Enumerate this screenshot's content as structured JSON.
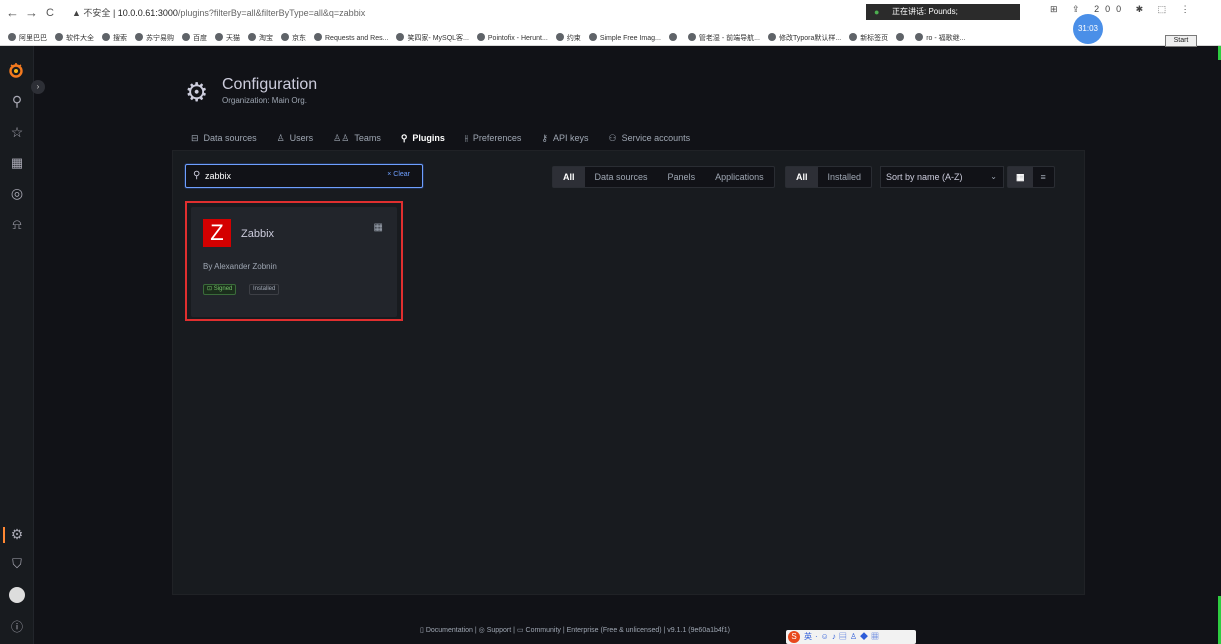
{
  "browser": {
    "nav": {
      "back": "←",
      "forward": "→",
      "reload": "C"
    },
    "security_label": "▲ 不安全",
    "url_host": "10.0.0.61:3000",
    "url_path": "/plugins?filterBy=all&filterByType=all&q=zabbix",
    "speech_text": "正在讲话: Pounds;",
    "clock_text": "31:03",
    "tray_text": "⊞ ⇪ 200 ✱ ⬚ ⋮",
    "start_label": "Start",
    "bookmarks": [
      "阿里巴巴",
      "软件大全",
      "搜索",
      "苏宁易购",
      "百度",
      "天猫",
      "淘宝",
      "京东",
      "Requests and Res...",
      "笑四家- MySQL客...",
      "Pointofix - Herunt...",
      "约束",
      "Simple Free Imag...",
      "",
      "管老湿 - 前端导航...",
      "修改Typora默认样...",
      "新标签页",
      "",
      "ro - 福歌继..."
    ]
  },
  "sidebar": {
    "icons": [
      "search-icon",
      "star-icon",
      "dashboards-icon",
      "explore-icon",
      "alerting-icon",
      "configuration-icon",
      "server-admin-icon",
      "profile-icon",
      "help-icon"
    ]
  },
  "header": {
    "title": "Configuration",
    "subtitle": "Organization: Main Org."
  },
  "tabs": [
    {
      "label": "Data sources",
      "icon": "⊟"
    },
    {
      "label": "Users",
      "icon": "♙"
    },
    {
      "label": "Teams",
      "icon": "♙♙"
    },
    {
      "label": "Plugins",
      "icon": "⚲"
    },
    {
      "label": "Preferences",
      "icon": "⫲"
    },
    {
      "label": "API keys",
      "icon": "⚷"
    },
    {
      "label": "Service accounts",
      "icon": "⚇"
    }
  ],
  "search": {
    "value": "zabbix",
    "clear_label": "× Clear"
  },
  "filters": {
    "type": [
      "All",
      "Data sources",
      "Panels",
      "Applications"
    ],
    "type_selected": "All",
    "install": [
      "All",
      "Installed"
    ],
    "install_selected": "All",
    "sort_label": "Sort by name (A-Z)"
  },
  "plugin": {
    "logo_letter": "Z",
    "name": "Zabbix",
    "author": "By Alexander Zobnin",
    "signed_label": "Signed",
    "installed_label": "Installed"
  },
  "footer": {
    "documentation": "Documentation",
    "support": "Support",
    "community": "Community",
    "enterprise": "Enterprise (Free & unlicensed)",
    "version": "v9.1.1 (9e60a1b4f1)"
  },
  "colors": {
    "accent": "#ff8833",
    "search_border": "#6e9fff",
    "highlight": "#e02f2f",
    "plugin_logo": "#d40000"
  }
}
